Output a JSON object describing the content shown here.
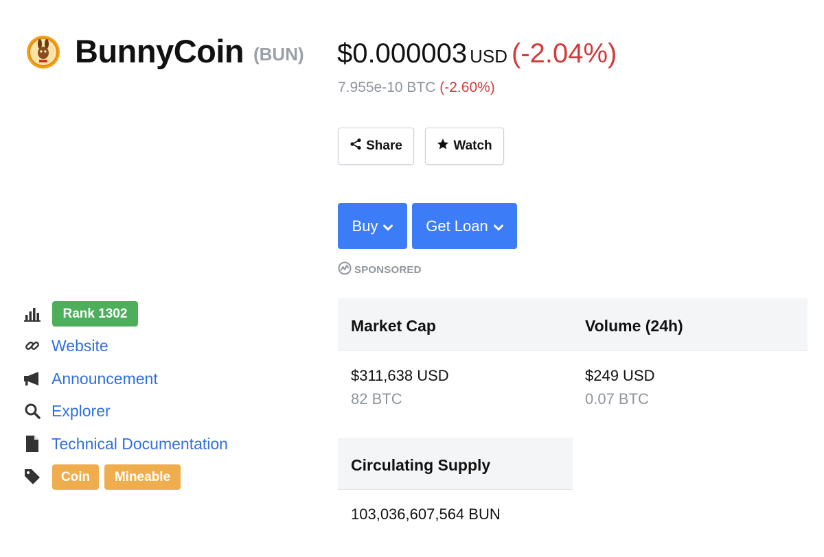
{
  "coin": {
    "name": "BunnyCoin",
    "symbol": "(BUN)",
    "logo_icon": "bunnycoin-logo"
  },
  "price": {
    "value": "$0.000003",
    "currency": "USD",
    "change": "(-2.04%)",
    "btc_value": "7.955e-10 BTC",
    "btc_change": "(-2.60%)",
    "negative_color": "#d23b3b"
  },
  "actions": {
    "share_label": "Share",
    "watch_label": "Watch",
    "buy_label": "Buy",
    "loan_label": "Get Loan",
    "sponsored_label": "SPONSORED",
    "accent_color": "#3d7cf7"
  },
  "sidebar": {
    "rank": "Rank 1302",
    "links": [
      {
        "label": "Website",
        "icon": "link-icon"
      },
      {
        "label": "Announcement",
        "icon": "megaphone-icon"
      },
      {
        "label": "Explorer",
        "icon": "search-icon"
      },
      {
        "label": "Technical Documentation",
        "icon": "document-icon"
      }
    ],
    "tags": [
      "Coin",
      "Mineable"
    ]
  },
  "stats": {
    "market_cap": {
      "label": "Market Cap",
      "usd": "$311,638 USD",
      "btc": "82 BTC"
    },
    "volume": {
      "label": "Volume (24h)",
      "usd": "$249 USD",
      "btc": "0.07 BTC"
    },
    "supply": {
      "label": "Circulating Supply",
      "value": "103,036,607,564 BUN"
    }
  }
}
